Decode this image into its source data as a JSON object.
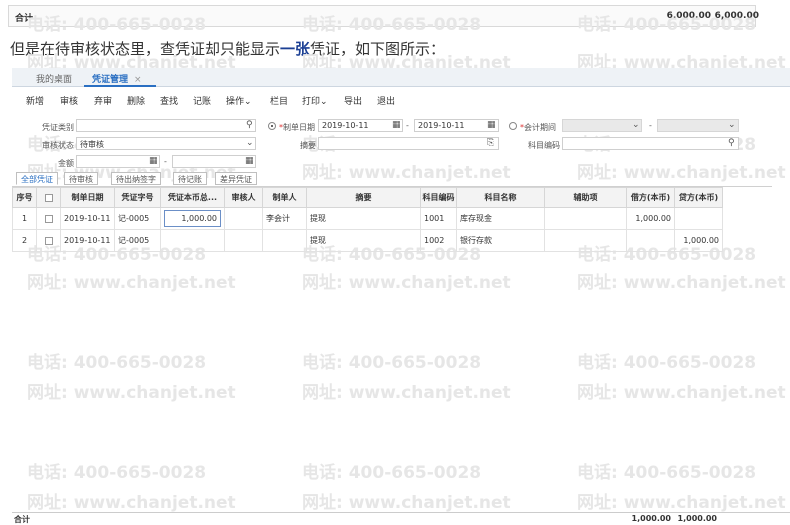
{
  "top_total": {
    "label": "合计",
    "debit": "6,000.00",
    "credit": "6,000.00"
  },
  "caption": {
    "prefix": "但是在待审核状态里，查凭证却只能显示",
    "emphasis": "一张",
    "suffix": "凭证，如下图所示："
  },
  "tabs": [
    {
      "label": "我的桌面"
    },
    {
      "label": "凭证管理",
      "close": "×"
    }
  ],
  "toolbar": [
    "新增",
    "审核",
    "弃审",
    "删除",
    "查找",
    "记账",
    "操作⌄",
    "栏目",
    "打印⌄",
    "导出",
    "退出"
  ],
  "filters": {
    "voucher_type_label": "凭证类别",
    "audit_status_label": "审核状态",
    "audit_status_value": "待审核",
    "amount_label": "金额",
    "date_radio_label": "制单日期",
    "date_from": "2019-10-11",
    "date_to": "2019-10-11",
    "period_radio_label": "会计期间",
    "summary_label": "摘要",
    "account_code_label": "科目编码",
    "range_sep": "-"
  },
  "subtabs": [
    "全部凭证",
    "待审核",
    "待出纳签字",
    "待记账",
    "差异凭证"
  ],
  "columns": [
    "序号",
    "",
    "制单日期",
    "凭证字号",
    "凭证本币总...",
    "审核人",
    "制单人",
    "摘要",
    "科目编码",
    "科目名称",
    "辅助项",
    "借方(本币)",
    "贷方(本币)"
  ],
  "rows": [
    {
      "seq": "1",
      "date": "2019-10-11",
      "voucher_no": "记-0005",
      "total": "1,000.00",
      "auditor": "",
      "maker": "李会计",
      "summary": "提现",
      "code": "1001",
      "account": "库存现金",
      "aux": "",
      "debit": "1,000.00",
      "credit": ""
    },
    {
      "seq": "2",
      "date": "2019-10-11",
      "voucher_no": "记-0005",
      "total": "",
      "auditor": "",
      "maker": "",
      "summary": "提现",
      "code": "1002",
      "account": "银行存款",
      "aux": "",
      "debit": "",
      "credit": "1,000.00"
    }
  ],
  "bottom_total": {
    "label": "合计",
    "debit": "1,000.00",
    "credit": "1,000.00"
  },
  "watermark": {
    "phone": "电话: 400-665-0028",
    "site": "网址: www.chanjet.net"
  },
  "icons": {
    "search": "search-icon",
    "calendar": "calendar-icon",
    "dropdown": "chevron-down-icon"
  }
}
